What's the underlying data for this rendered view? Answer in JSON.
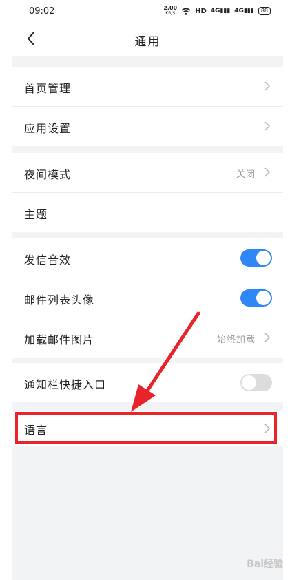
{
  "status": {
    "time": "09:02",
    "speed_value": "2.00",
    "speed_unit": "KB/S",
    "network": "HD",
    "signal1": "4G",
    "signal2": "4G",
    "battery": "88"
  },
  "nav": {
    "title": "通用"
  },
  "groups": [
    {
      "rows": [
        {
          "label": "首页管理"
        },
        {
          "label": "应用设置"
        }
      ]
    },
    {
      "rows": [
        {
          "label": "夜间模式",
          "value": "关闭"
        },
        {
          "label": "主题"
        }
      ]
    },
    {
      "rows": [
        {
          "label": "发信音效",
          "toggle": true
        },
        {
          "label": "邮件列表头像",
          "toggle": true
        },
        {
          "label": "加载邮件图片",
          "value": "始终加载"
        }
      ]
    },
    {
      "rows": [
        {
          "label": "通知栏快捷入口",
          "toggle": false
        }
      ]
    },
    {
      "rows": [
        {
          "label": "语言"
        }
      ]
    }
  ],
  "colors": {
    "accent": "#2f86f6",
    "highlight": "#e8232a",
    "background": "#f2f3f5"
  },
  "watermark": "Bai经验"
}
